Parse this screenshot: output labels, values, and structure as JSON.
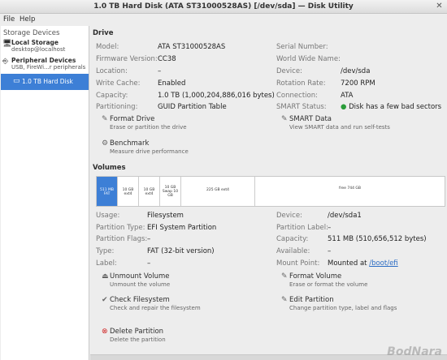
{
  "window": {
    "title": "1.0 TB Hard Disk (ATA ST31000528AS) [/dev/sda] — Disk Utility"
  },
  "menu": {
    "file": "File",
    "help": "Help"
  },
  "sidebar": {
    "header": "Storage Devices",
    "items": [
      {
        "label": "Local Storage",
        "sub": "desktop@localhost"
      },
      {
        "label": "Peripheral Devices",
        "sub": "USB, FireWi...r peripherals"
      }
    ],
    "selected": "1.0 TB Hard Disk"
  },
  "drive": {
    "section": "Drive",
    "left": [
      {
        "label": "Model:",
        "value": "ATA ST31000528AS"
      },
      {
        "label": "Firmware Version:",
        "value": "CC38"
      },
      {
        "label": "Location:",
        "value": "–"
      },
      {
        "label": "Write Cache:",
        "value": "Enabled"
      },
      {
        "label": "Capacity:",
        "value": "1.0 TB (1,000,204,886,016 bytes)"
      },
      {
        "label": "Partitioning:",
        "value": "GUID Partition Table"
      }
    ],
    "right": [
      {
        "label": "Serial Number:",
        "value": ""
      },
      {
        "label": "World Wide Name:",
        "value": ""
      },
      {
        "label": "Device:",
        "value": "/dev/sda"
      },
      {
        "label": "Rotation Rate:",
        "value": "7200 RPM"
      },
      {
        "label": "Connection:",
        "value": "ATA"
      },
      {
        "label": "SMART Status:",
        "value": "Disk has a few bad sectors"
      }
    ],
    "actions": [
      {
        "name": "Format Drive",
        "desc": "Erase or partition the drive"
      },
      {
        "name": "SMART Data",
        "desc": "View SMART data and run self-tests"
      },
      {
        "name": "Benchmark",
        "desc": "Measure drive performance"
      }
    ]
  },
  "volumes": {
    "section": "Volumes",
    "segments": [
      "511 MB FAT",
      "10 GB ext4",
      "10 GB ext4",
      "10 GB Swap 10 GB",
      "225 GB ext4",
      "free 744 GB"
    ],
    "left": [
      {
        "label": "Usage:",
        "value": "Filesystem"
      },
      {
        "label": "Partition Type:",
        "value": "EFI System Partition"
      },
      {
        "label": "Partition Flags:",
        "value": "–"
      },
      {
        "label": "Type:",
        "value": "FAT (32-bit version)"
      },
      {
        "label": "Label:",
        "value": "–"
      }
    ],
    "right": [
      {
        "label": "Device:",
        "value": "/dev/sda1"
      },
      {
        "label": "Partition Label:",
        "value": "–"
      },
      {
        "label": "Capacity:",
        "value": "511 MB (510,656,512 bytes)"
      },
      {
        "label": "Available:",
        "value": "–"
      },
      {
        "label": "Mount Point:",
        "value": "Mounted at",
        "link": "/boot/efi"
      }
    ],
    "actions": [
      {
        "name": "Unmount Volume",
        "desc": "Unmount the volume"
      },
      {
        "name": "Format Volume",
        "desc": "Erase or format the volume"
      },
      {
        "name": "Check Filesystem",
        "desc": "Check and repair the filesystem"
      },
      {
        "name": "Edit Partition",
        "desc": "Change partition type, label and flags"
      },
      {
        "name": "Delete Partition",
        "desc": "Delete the partition"
      }
    ]
  },
  "watermark": "BodNara"
}
